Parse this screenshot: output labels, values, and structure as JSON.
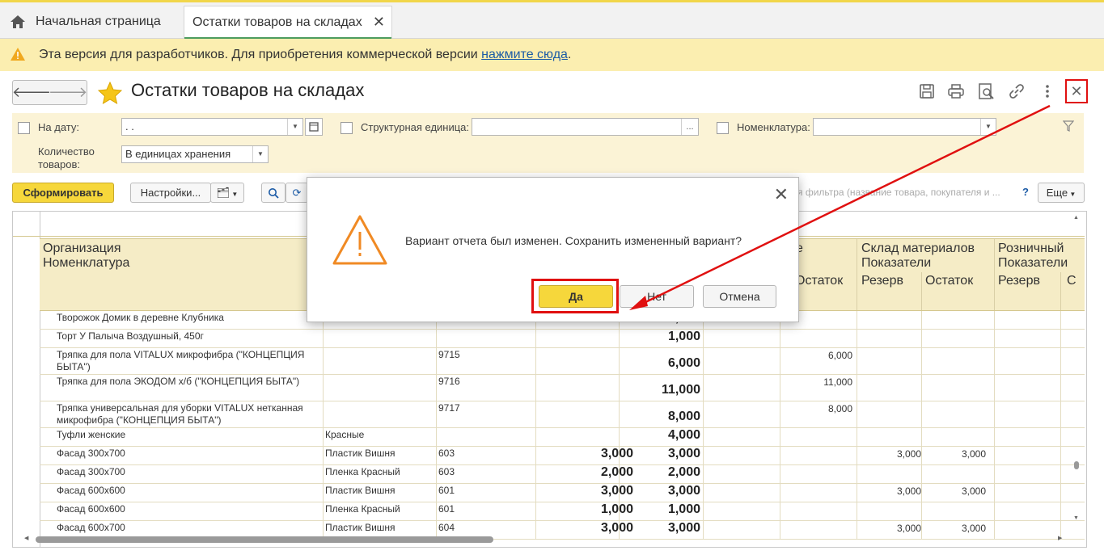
{
  "tabs": {
    "home": "Начальная страница",
    "active": "Остатки товаров на складах"
  },
  "warning": {
    "text": "Эта версия для разработчиков. Для приобретения коммерческой версии ",
    "link": "нажмите сюда",
    "tail": "."
  },
  "header": {
    "title": "Остатки товаров на складах"
  },
  "filters": {
    "date_label": "На дату:",
    "date_value": " .  .",
    "unit_label": "Структурная единица:",
    "nomen_label": "Номенклатура:",
    "qty_label": "Количество товаров:",
    "qty_value": "В единицах хранения"
  },
  "toolbar": {
    "form": "Сформировать",
    "settings": "Настройки...",
    "search_placeholder": "я фильтра (название товара, покупателя и ...",
    "help": "?",
    "more": "Еще"
  },
  "table": {
    "h_org": "Организация",
    "h_nomen": "Номенклатура",
    "h_col1": "е",
    "h_sklad": "Склад материалов",
    "h_retail": "Розничный",
    "h_pokaz1": "Показатели",
    "h_pokaz2": "Показатели",
    "h_ost": "Остаток",
    "h_rezerv1": "Резерв",
    "h_ost2": "Остаток",
    "h_rezerv2": "Резерв",
    "h_c": "С",
    "rows": [
      {
        "name": "Творожок Домик в деревне Клубника",
        "char": "",
        "art": "",
        "res": "",
        "total": "1,000",
        "ost": "",
        "r2": "",
        "o2": ""
      },
      {
        "name": "Торт У Палыча Воздушный, 450г",
        "char": "",
        "art": "",
        "res": "",
        "total": "1,000",
        "ost": "",
        "r2": "",
        "o2": ""
      },
      {
        "name": "Тряпка для пола VITALUX микрофибра (\"КОНЦЕПЦИЯ БЫТА\")",
        "char": "",
        "art": "9715",
        "res": "",
        "total": "6,000",
        "ost": "6,000",
        "r2": "",
        "o2": ""
      },
      {
        "name": "Тряпка для пола ЭКОДОМ х/б (\"КОНЦЕПЦИЯ БЫТА\")",
        "char": "",
        "art": "9716",
        "res": "",
        "total": "11,000",
        "ost": "11,000",
        "r2": "",
        "o2": ""
      },
      {
        "name": "Тряпка универсальная для уборки VITALUX нетканная микрофибра  (\"КОНЦЕПЦИЯ БЫТА\")",
        "char": "",
        "art": "9717",
        "res": "",
        "total": "8,000",
        "ost": "8,000",
        "r2": "",
        "o2": ""
      },
      {
        "name": "Туфли женские",
        "char": "Красные",
        "art": "",
        "res": "",
        "total": "4,000",
        "ost": "",
        "r2": "",
        "o2": ""
      },
      {
        "name": "Фасад 300х700",
        "char": "Пластик Вишня",
        "art": "603",
        "res": "3,000",
        "total": "3,000",
        "ost": "",
        "r2": "3,000",
        "o2": "3,000"
      },
      {
        "name": "Фасад 300х700",
        "char": "Пленка Красный",
        "art": "603",
        "res": "2,000",
        "total": "2,000",
        "ost": "",
        "r2": "",
        "o2": ""
      },
      {
        "name": "Фасад 600х600",
        "char": "Пластик Вишня",
        "art": "601",
        "res": "3,000",
        "total": "3,000",
        "ost": "",
        "r2": "3,000",
        "o2": "3,000"
      },
      {
        "name": "Фасад 600х600",
        "char": "Пленка Красный",
        "art": "601",
        "res": "1,000",
        "total": "1,000",
        "ost": "",
        "r2": "",
        "o2": ""
      },
      {
        "name": "Фасад 600х700",
        "char": "Пластик Вишня",
        "art": "604",
        "res": "3,000",
        "total": "3,000",
        "ost": "",
        "r2": "3,000",
        "o2": "3,000"
      }
    ]
  },
  "dialog": {
    "message": "Вариант отчета был изменен. Сохранить измененный вариант?",
    "yes": "Да",
    "no": "Нет",
    "cancel": "Отмена"
  },
  "colors": {
    "accent_yellow": "#f6d73b",
    "highlight_red": "#e01010",
    "header_bg": "#f5ecc6"
  }
}
